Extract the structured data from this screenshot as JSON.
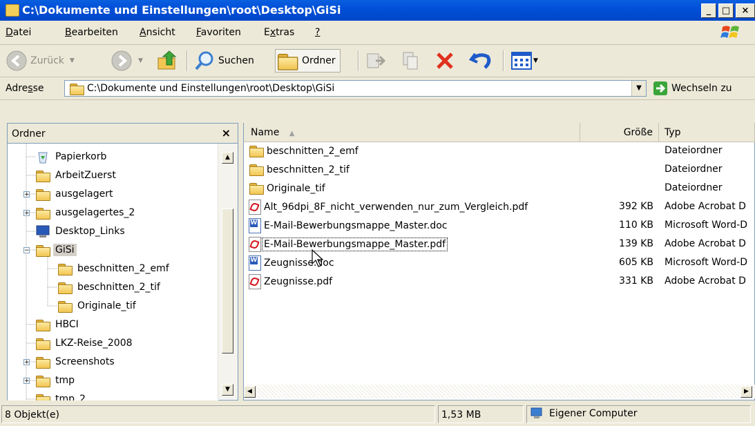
{
  "window": {
    "title": "C:\\Dokumente und Einstellungen\\root\\Desktop\\GiSi"
  },
  "menu": {
    "items": [
      {
        "pre": "",
        "u": "D",
        "post": "atei"
      },
      {
        "pre": "",
        "u": "B",
        "post": "earbeiten"
      },
      {
        "pre": "",
        "u": "A",
        "post": "nsicht"
      },
      {
        "pre": "",
        "u": "F",
        "post": "avoriten"
      },
      {
        "pre": "E",
        "u": "x",
        "post": "tras"
      },
      {
        "pre": "",
        "u": "?",
        "post": ""
      }
    ]
  },
  "toolbar": {
    "back": "Zurück",
    "search": "Suchen",
    "folders": "Ordner"
  },
  "address": {
    "label_pre": "Adre",
    "label_u": "s",
    "label_post": "se",
    "value": "C:\\Dokumente und Einstellungen\\root\\Desktop\\GiSi",
    "go": "Wechseln zu"
  },
  "folders": {
    "title": "Ordner",
    "close": "×",
    "tree": [
      {
        "label": "Papierkorb",
        "icon": "recycle-bin-icon",
        "expander": ""
      },
      {
        "label": "ArbeitZuerst",
        "icon": "folder-icon",
        "expander": ""
      },
      {
        "label": "ausgelagert",
        "icon": "folder-icon",
        "expander": "+"
      },
      {
        "label": "ausgelagertes_2",
        "icon": "folder-icon",
        "expander": "+"
      },
      {
        "label": "Desktop_Links",
        "icon": "monitor-icon",
        "expander": ""
      },
      {
        "label": "GiSi",
        "icon": "folder-icon",
        "expander": "−",
        "selected": true
      },
      {
        "label": "beschnitten_2_emf",
        "icon": "folder-icon",
        "expander": ""
      },
      {
        "label": "beschnitten_2_tif",
        "icon": "folder-icon",
        "expander": ""
      },
      {
        "label": "Originale_tif",
        "icon": "folder-icon",
        "expander": ""
      },
      {
        "label": "HBCI",
        "icon": "folder-icon",
        "expander": ""
      },
      {
        "label": "LKZ-Reise_2008",
        "icon": "folder-icon",
        "expander": ""
      },
      {
        "label": "Screenshots",
        "icon": "folder-icon",
        "expander": "+"
      },
      {
        "label": "tmp",
        "icon": "folder-icon",
        "expander": "+"
      },
      {
        "label": "tmp_2",
        "icon": "folder-icon",
        "expander": ""
      }
    ]
  },
  "files": {
    "columns": {
      "name": "Name",
      "size": "Größe",
      "type": "Typ"
    },
    "rows": [
      {
        "name": "beschnitten_2_emf",
        "size": "",
        "type": "Dateiordner",
        "icon": "folder-icon"
      },
      {
        "name": "beschnitten_2_tif",
        "size": "",
        "type": "Dateiordner",
        "icon": "folder-icon"
      },
      {
        "name": "Originale_tif",
        "size": "",
        "type": "Dateiordner",
        "icon": "folder-icon"
      },
      {
        "name": "Alt_96dpi_8F_nicht_verwenden_nur_zum_Vergleich.pdf",
        "size": "392 KB",
        "type": "Adobe Acrobat D",
        "icon": "pdf-icon"
      },
      {
        "name": "E-Mail-Bewerbungsmappe_Master.doc",
        "size": "110 KB",
        "type": "Microsoft Word-D",
        "icon": "word-doc-icon"
      },
      {
        "name": "E-Mail-Bewerbungsmappe_Master.pdf",
        "size": "139 KB",
        "type": "Adobe Acrobat D",
        "icon": "pdf-icon",
        "focused": true
      },
      {
        "name": "Zeugnisse.doc",
        "size": "605 KB",
        "type": "Microsoft Word-D",
        "icon": "word-doc-icon"
      },
      {
        "name": "Zeugnisse.pdf",
        "size": "331 KB",
        "type": "Adobe Acrobat D",
        "icon": "pdf-icon"
      }
    ]
  },
  "status": {
    "count": "8 Objekt(e)",
    "size": "1,53 MB",
    "zone": "Eigener Computer"
  }
}
